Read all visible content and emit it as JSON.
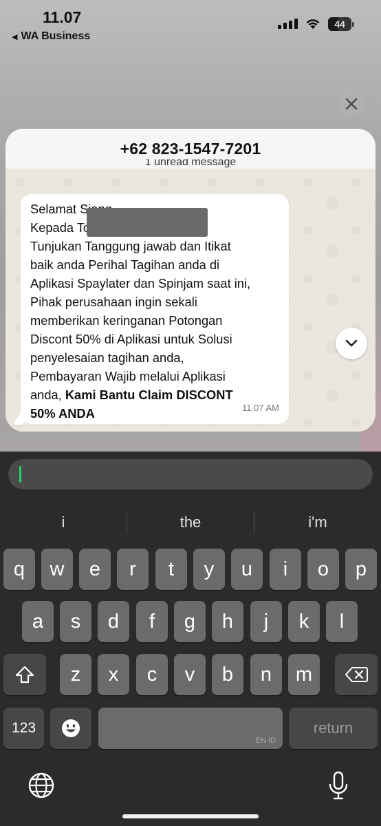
{
  "status_bar": {
    "time": "11.07",
    "back_app": "WA Business",
    "battery": "44"
  },
  "preview": {
    "contact": "+62 823-1547-7201",
    "unread_banner": "1 unread message",
    "message": {
      "lines": [
        "Selamat Siang",
        "Kepada                                  Tolong",
        "Tunjukan Tanggung jawab dan Itikat",
        "baik anda Perihal Tagihan anda di",
        "Aplikasi Spaylater dan Spinjam saat ini,",
        "Pihak perusahaan ingin sekali",
        "memberikan keringanan Potongan",
        "Discont 50% di Aplikasi untuk Solusi",
        "penyelesaian tagihan anda,",
        "Pembayaran Wajib melalui Aplikasi"
      ],
      "last_line_prefix": "anda, ",
      "bold_text_1": "Kami Bantu Claim DISCONT",
      "bold_text_2": "50% ANDA",
      "time": "11.07 AM"
    }
  },
  "keyboard": {
    "suggestions": [
      "i",
      "the",
      "i'm"
    ],
    "row1": [
      "q",
      "w",
      "e",
      "r",
      "t",
      "y",
      "u",
      "i",
      "o",
      "p"
    ],
    "row2": [
      "a",
      "s",
      "d",
      "f",
      "g",
      "h",
      "j",
      "k",
      "l"
    ],
    "row3": [
      "z",
      "x",
      "c",
      "v",
      "b",
      "n",
      "m"
    ],
    "numbers_key": "123",
    "space_language": "EN ID",
    "return_key": "return"
  },
  "icons": {
    "close": "close-icon",
    "scroll_down": "chevron-down-icon",
    "shift": "shift-icon",
    "delete": "backspace-icon",
    "emoji": "emoji-icon",
    "globe": "globe-icon",
    "mic": "microphone-icon"
  }
}
